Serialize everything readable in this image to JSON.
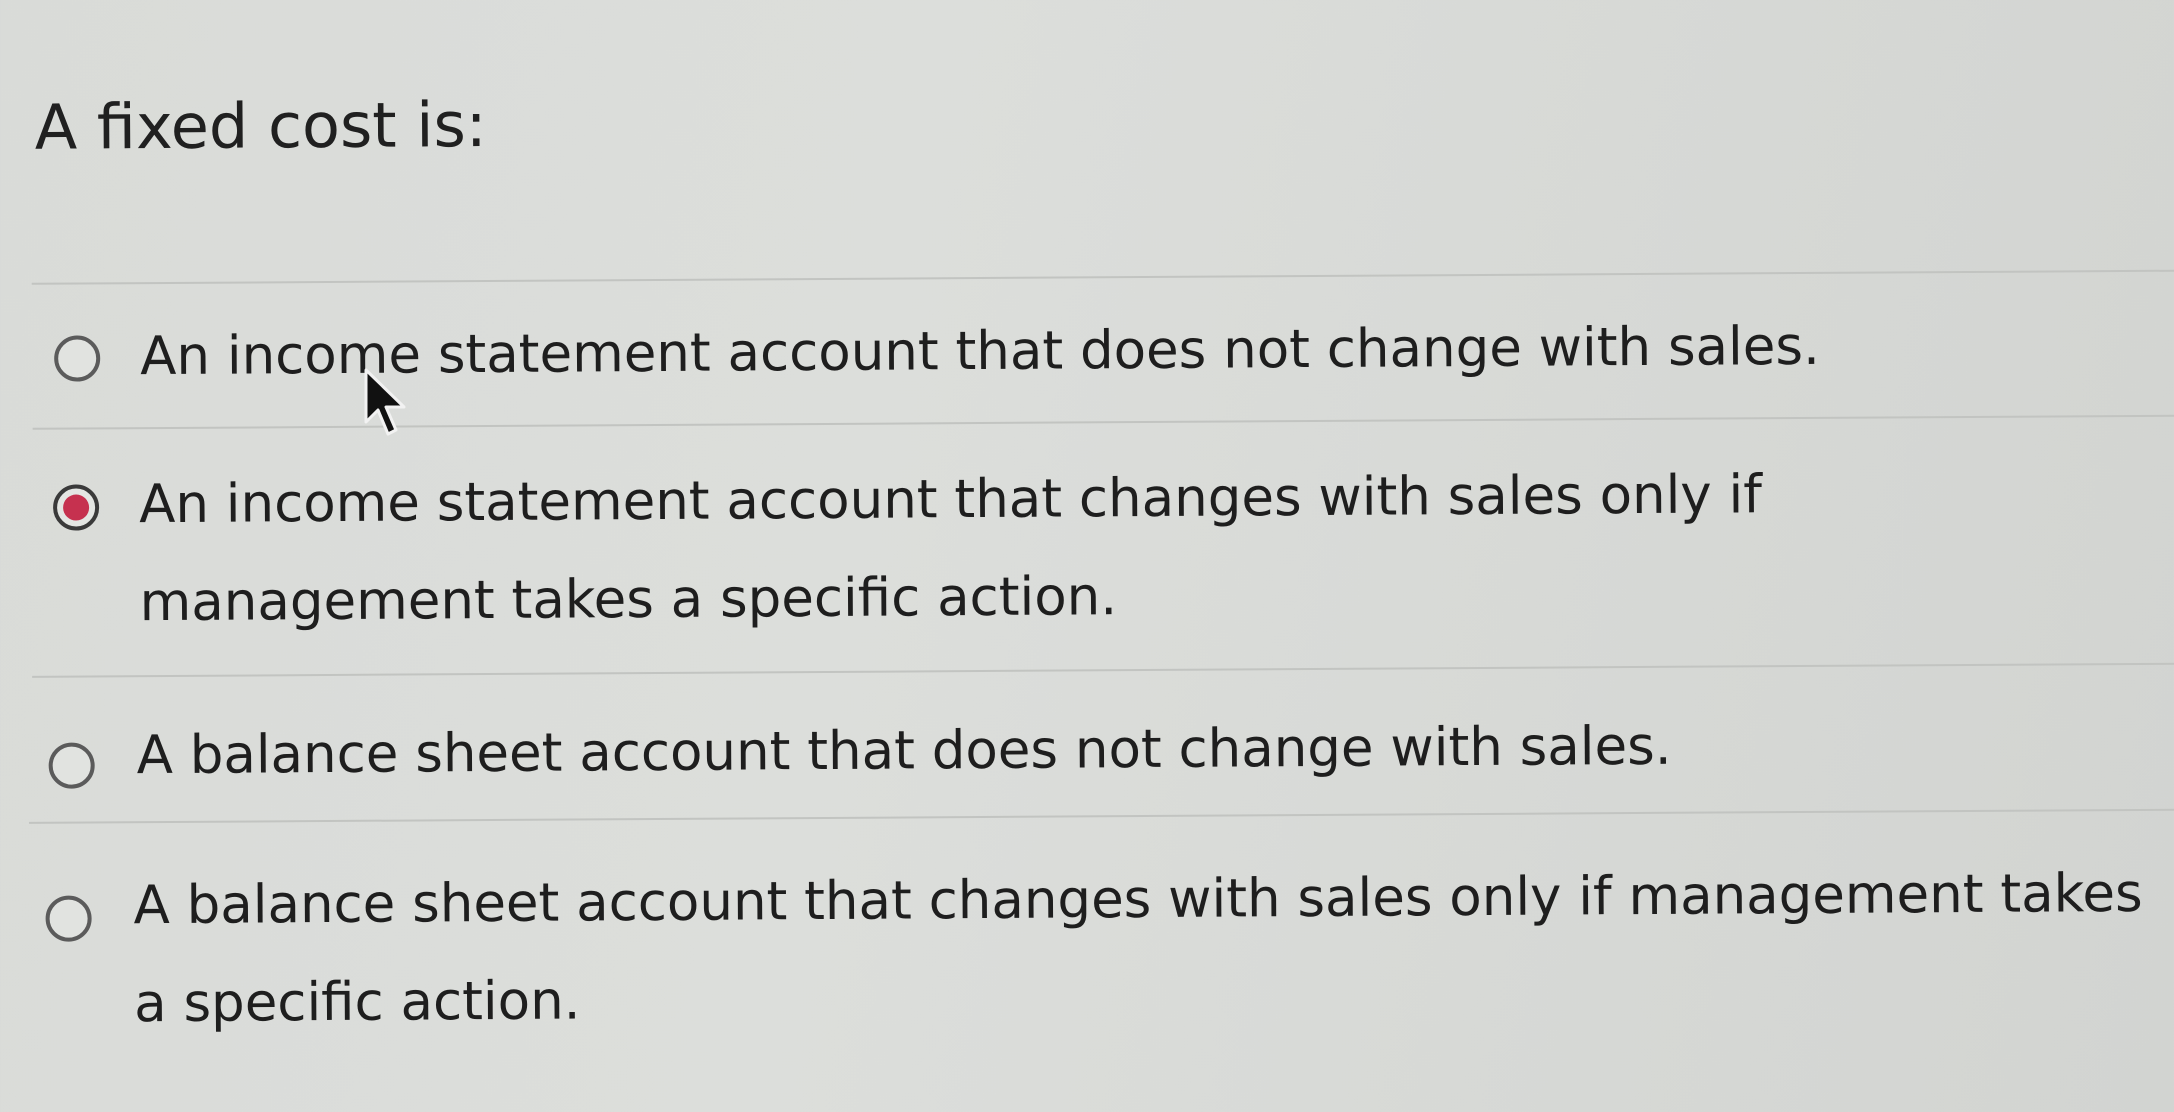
{
  "question": {
    "text": "A fixed cost is:"
  },
  "options": [
    {
      "label": "An income statement account that does not change with sales.",
      "selected": false
    },
    {
      "label": "An income statement account that changes with sales only if management takes a specific action.",
      "selected": true
    },
    {
      "label": "A balance sheet account that does not change with sales.",
      "selected": false
    },
    {
      "label": "A balance sheet account that changes with sales only if management takes a specific action.",
      "selected": false
    }
  ],
  "colors": {
    "selected_radio": "#c6314f",
    "background": "#dadcd9",
    "divider": "#c2c4c1"
  },
  "icons": {
    "cursor": "mouse-pointer-icon"
  }
}
